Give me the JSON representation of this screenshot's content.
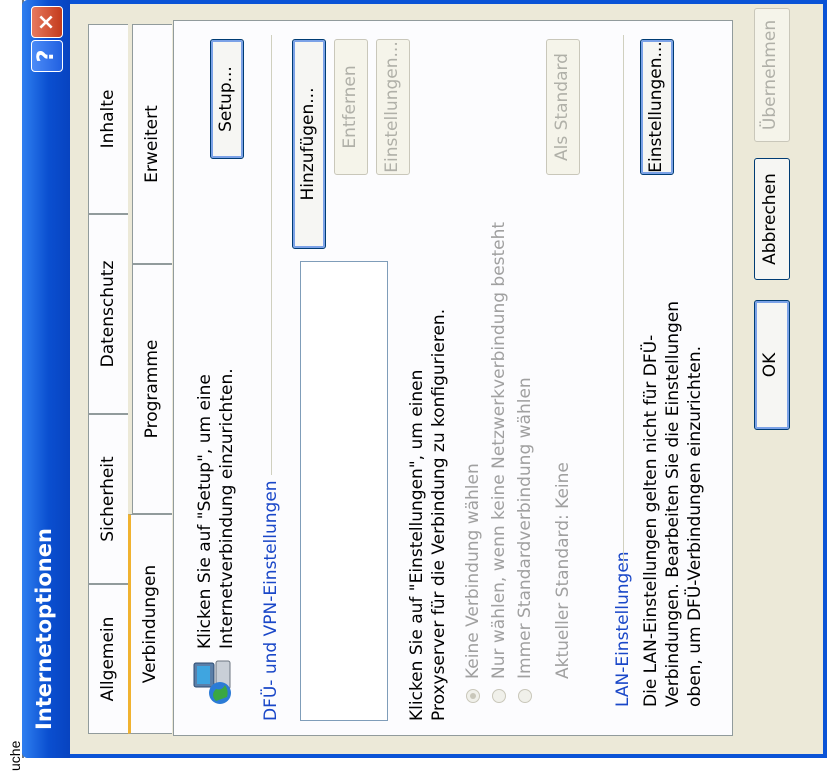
{
  "background": {
    "window_text": "uche"
  },
  "dialog": {
    "title": "Internetoptionen",
    "help_label": "?",
    "close_label": "×",
    "tabs": [
      {
        "label": "Allgemein"
      },
      {
        "label": "Sicherheit"
      },
      {
        "label": "Datenschutz"
      },
      {
        "label": "Inhalte"
      },
      {
        "label": "Verbindungen"
      },
      {
        "label": "Programme"
      },
      {
        "label": "Erweitert"
      }
    ],
    "setup": {
      "text_line1": "Klicken Sie auf \"Setup\", um eine",
      "text_line2": "Internetverbindung einzurichten.",
      "button": "Setup..."
    },
    "dfu": {
      "heading": "DFÜ- und VPN-Einstellungen",
      "add_button": "Hinzufügen...",
      "remove_button": "Entfernen",
      "settings_button": "Einstellungen...",
      "text_line1": "Klicken Sie auf \"Einstellungen\", um einen",
      "text_line2": "Proxyserver für die Verbindung zu konfigurieren.",
      "options": [
        "Keine Verbindung wählen",
        "Nur wählen, wenn keine Netzwerkverbindung besteht",
        "Immer Standardverbindung wählen"
      ],
      "current_default": "Aktueller Standard:  Keine",
      "default_button": "Als Standard"
    },
    "lan": {
      "heading": "LAN-Einstellungen",
      "text_line1": "Die LAN-Einstellungen gelten nicht für DFÜ-",
      "text_line2": "Verbindungen. Bearbeiten Sie die Einstellungen",
      "text_line3": "oben, um DFÜ-Verbindungen einzurichten.",
      "button": "Einstellungen..."
    },
    "footer": {
      "ok": "OK",
      "cancel": "Abbrechen",
      "apply": "Übernehmen"
    },
    "colors": {
      "titlebar": "#0a53d6",
      "face": "#ece9d8",
      "link_blue": "#1a47c8"
    }
  }
}
